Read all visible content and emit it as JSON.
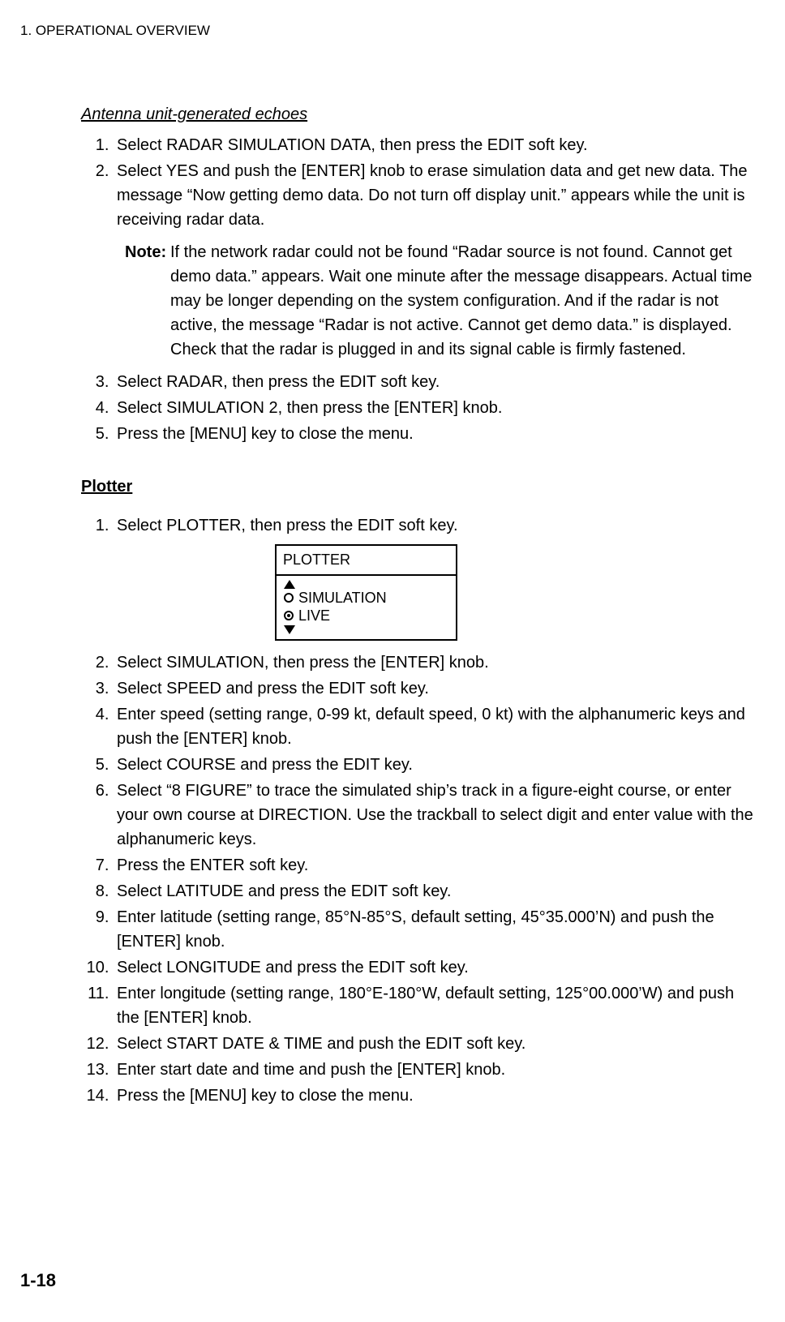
{
  "header": "1. OPERATIONAL OVERVIEW",
  "section1": {
    "title": "Antenna unit-generated echoes",
    "items": [
      "Select RADAR SIMULATION DATA, then press the EDIT soft key.",
      "Select YES and push the [ENTER] knob to erase simulation data and get new data. The message “Now getting demo data. Do not turn off display unit.” appears while the unit is receiving radar data."
    ],
    "note_label": "Note:",
    "note_body": "If the network radar could not be found “Radar source is not found. Cannot get demo data.” appears. Wait one minute after the message disappears. Actual time may be longer depending on the system configuration. And if the radar is not active, the message “Radar is not active. Cannot get demo data.” is displayed. Check that the radar is plugged in and its signal cable is firmly fastened.",
    "items_after": [
      "Select RADAR, then press the EDIT soft key.",
      "Select SIMULATION 2, then press the [ENTER] knob.",
      "Press the [MENU] key to close the menu."
    ]
  },
  "section2": {
    "title": "Plotter",
    "item1": "Select PLOTTER, then press the EDIT soft key.",
    "box_title": "PLOTTER",
    "box_opt1": "SIMULATION",
    "box_opt2": "LIVE",
    "items": [
      "Select SIMULATION, then press the [ENTER] knob.",
      "Select SPEED and press the EDIT soft key.",
      "Enter speed (setting range, 0-99 kt, default speed, 0 kt) with the alphanumeric keys and push the [ENTER] knob.",
      "Select COURSE and press the EDIT key.",
      "Select “8 FIGURE” to trace the simulated ship’s track in a figure-eight course, or enter your own course at DIRECTION. Use the trackball to select digit and enter value with the alphanumeric keys.",
      "Press the ENTER soft key.",
      "Select LATITUDE and press the EDIT soft key.",
      "Enter latitude (setting range, 85°N-85°S, default setting, 45°35.000’N) and push the [ENTER] knob.",
      "Select LONGITUDE and press the EDIT soft key.",
      "Enter longitude (setting range, 180°E-180°W, default setting, 125°00.000’W) and push the [ENTER] knob.",
      "Select START DATE & TIME and push the EDIT soft key.",
      "Enter start date and time and push the [ENTER] knob.",
      "Press the [MENU] key to close the menu."
    ]
  },
  "page_number": "1-18"
}
